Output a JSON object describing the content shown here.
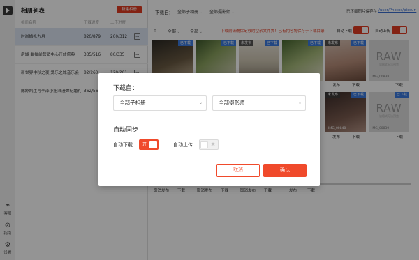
{
  "rail": {
    "items": [
      {
        "icon": "headset-icon",
        "label": "客服"
      },
      {
        "icon": "help-icon",
        "label": "指南"
      },
      {
        "icon": "gear-icon",
        "label": "设置"
      }
    ]
  },
  "album": {
    "title": "相册列表",
    "create_label": "新建相册",
    "columns": [
      "相册名称",
      "下载进度",
      "上传进度"
    ],
    "rows": [
      {
        "name": "时尚婚礼九月",
        "download": "820/879",
        "upload": "200/312"
      },
      {
        "name": "房城·曲技前营销中心开放盛典",
        "download": "335/516",
        "upload": "80/335"
      },
      {
        "name": "新世界中秋之夜·爱乐之城音乐会",
        "download": "82/260",
        "upload": "120/201"
      },
      {
        "name": "陈舒凯生与李泽小姐浪漫世纪婚礼",
        "download": "362/56",
        "upload": ""
      }
    ]
  },
  "topbar": {
    "download_from": "下载自：",
    "album_select": "全部子相册",
    "photographer_select": "全部摄影师",
    "save_prefix": "已下载图片保存在：",
    "save_path": "/user/Photos/picsurl"
  },
  "filter": {
    "select_a": "全部",
    "select_b": "全部",
    "notice": "下载前请确保足够的空余文件夹！已有内容将保存于下载目录",
    "auto_download": "自动下载",
    "auto_upload": "自动上传"
  },
  "photos": [
    {
      "left": "",
      "right": "已下载",
      "kind": "dark",
      "a": "",
      "b": ""
    },
    {
      "left": "",
      "right": "已下载",
      "kind": "plants",
      "a": "",
      "b": ""
    },
    {
      "left": "未发布",
      "right": "已下载",
      "kind": "bright",
      "a": "",
      "b": ""
    },
    {
      "left": "",
      "right": "已下载",
      "kind": "plants",
      "a": "",
      "b": ""
    },
    {
      "left": "未发布",
      "right": "已下载",
      "kind": "pink",
      "a": "发布",
      "b": "下载"
    },
    {
      "left": "",
      "right": "",
      "kind": "raw",
      "raw": "RAW",
      "raw_sub": "该格式无法预览",
      "fname": "IMG_00838",
      "a": "",
      "b": "下载"
    },
    {
      "left": "未发布",
      "right": "已下载",
      "kind": "dark",
      "fname": "IMG_00848",
      "a": "发布",
      "b": "下载"
    },
    {
      "left": "",
      "right": "已下载",
      "kind": "raw",
      "raw": "RAW",
      "raw_sub": "该格式无法预览",
      "fname": "IMG_00839",
      "a": "",
      "b": "下载"
    }
  ],
  "bottom_row_actions": [
    "取消发布",
    "下载",
    "取消发布",
    "下载",
    "取消发布",
    "下载",
    "发布",
    "下载"
  ],
  "dialog": {
    "title": "下载自：",
    "album_select": "全部子相册",
    "photographer_select": "全部摄影师",
    "sync_title": "自动同步",
    "auto_download_label": "自动下载",
    "auto_download_state": "开",
    "auto_upload_label": "自动上传",
    "auto_upload_state": "关",
    "cancel_label": "取消",
    "confirm_label": "确认"
  },
  "colors": {
    "accent": "#f04a2b",
    "link": "#3b6fd1",
    "badge_blue": "#3b7be0"
  }
}
